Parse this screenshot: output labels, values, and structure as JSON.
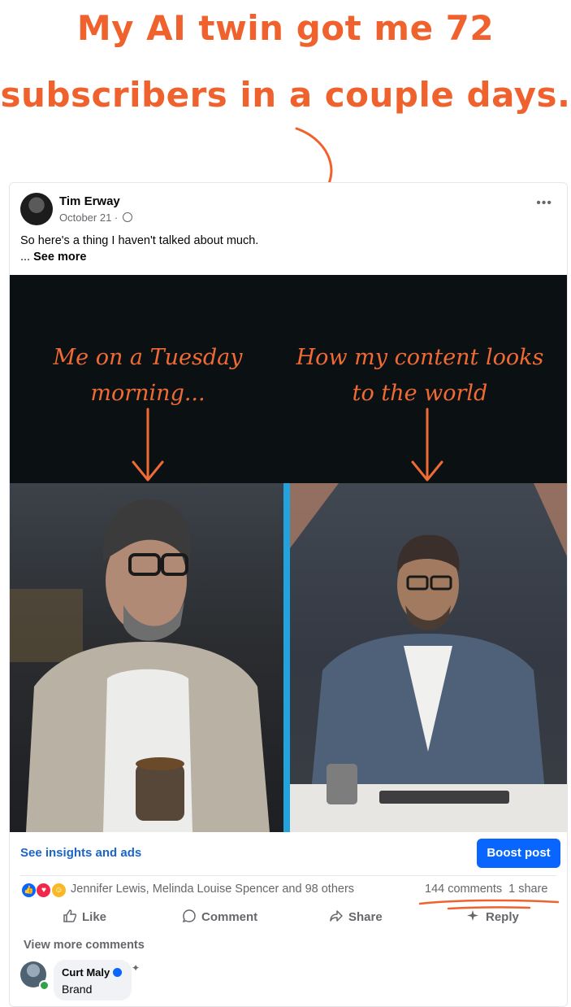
{
  "headline": {
    "line1": "My AI twin got me 72",
    "line2": "subscribers in a couple days."
  },
  "post": {
    "author": "Tim Erway",
    "date": "October 21 ·",
    "more_icon": "•••",
    "text": "So here's a thing I haven't talked about much.",
    "see_more_prefix": "... ",
    "see_more": "See more",
    "image": {
      "caption_left": "Me on a Tuesday morning...",
      "caption_right": "How my content looks to the world"
    },
    "insights_link": "See insights and ads",
    "boost_button": "Boost post",
    "reactions": {
      "icons": [
        "like-icon",
        "love-icon",
        "haha-icon"
      ],
      "names": "Jennifer Lewis, Melinda Louise Spencer and 98 others",
      "comments": "144 comments",
      "shares": "1 share"
    },
    "actions": {
      "like": "Like",
      "comment": "Comment",
      "share": "Share",
      "reply": "Reply"
    },
    "view_more_comments": "View more comments",
    "comment": {
      "name": "Curt Maly",
      "body": "Brand"
    }
  },
  "colors": {
    "accent_orange": "#f0622d",
    "facebook_blue": "#0866ff",
    "link_blue": "#1b64c8",
    "divider_blue": "#23a3dd"
  }
}
